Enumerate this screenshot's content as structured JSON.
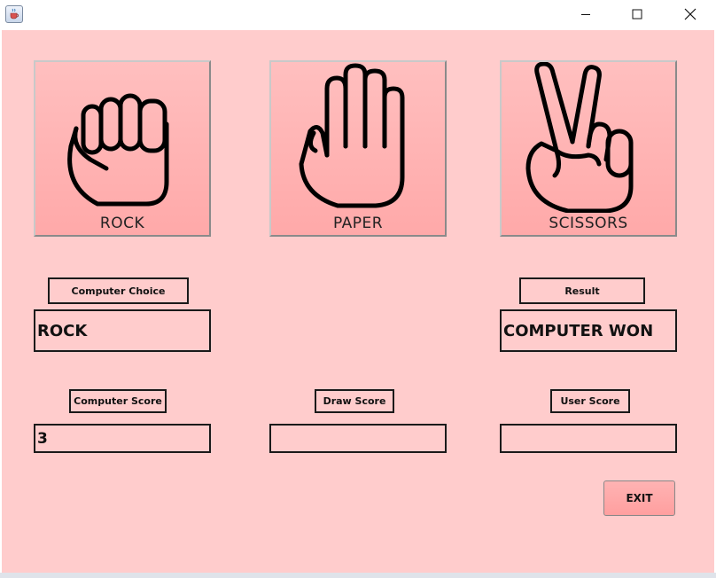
{
  "window": {
    "icon": "java-cup-icon",
    "controls": {
      "minimize": "minimize-icon",
      "maximize": "maximize-icon",
      "close": "close-icon"
    }
  },
  "choices": {
    "rock_label": "ROCK",
    "paper_label": "PAPER",
    "scissors_label": "SCISSORS"
  },
  "labels": {
    "computer_choice": "Computer Choice",
    "result": "Result",
    "computer_score": "Computer Score",
    "draw_score": "Draw Score",
    "user_score": "User Score"
  },
  "values": {
    "computer_choice": "ROCK",
    "result": "COMPUTER WON",
    "computer_score": "3",
    "draw_score": "",
    "user_score": ""
  },
  "buttons": {
    "exit": "EXIT"
  },
  "colors": {
    "background": "#ffcccc",
    "button_fill": "#ffaaaa",
    "border": "#1a1a1a"
  }
}
